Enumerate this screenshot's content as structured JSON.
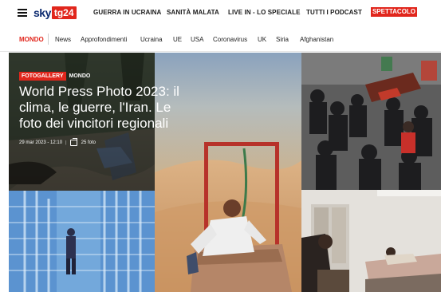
{
  "logo": {
    "sky": "sky",
    "tg": "tg24"
  },
  "top_nav": [
    {
      "label": "GUERRA IN UCRAINA"
    },
    {
      "label": "SANITÀ MALATA"
    },
    {
      "label": "LIVE IN - LO SPECIALE"
    },
    {
      "label": "TUTTI I PODCAST"
    },
    {
      "label": "SPETTACOLO"
    }
  ],
  "sub_nav": [
    {
      "label": "MONDO",
      "active": true
    },
    {
      "label": "News"
    },
    {
      "label": "Approfondimenti"
    },
    {
      "label": "Ucraina"
    },
    {
      "label": "UE"
    },
    {
      "label": "USA"
    },
    {
      "label": "Coronavirus"
    },
    {
      "label": "UK"
    },
    {
      "label": "Siria"
    },
    {
      "label": "Afghanistan"
    }
  ],
  "article": {
    "tag_gallery": "FOTOGALLERY",
    "tag_section": "MONDO",
    "headline": "World Press Photo 2023: il clima, le guerre, l'Iran. Le foto dei vincitori regionali",
    "date": "29 mar 2023 - 12:10",
    "separator": "|",
    "photo_count": "25 foto"
  },
  "colors": {
    "accent": "#e1261c",
    "brand_blue": "#0b2a6f"
  }
}
